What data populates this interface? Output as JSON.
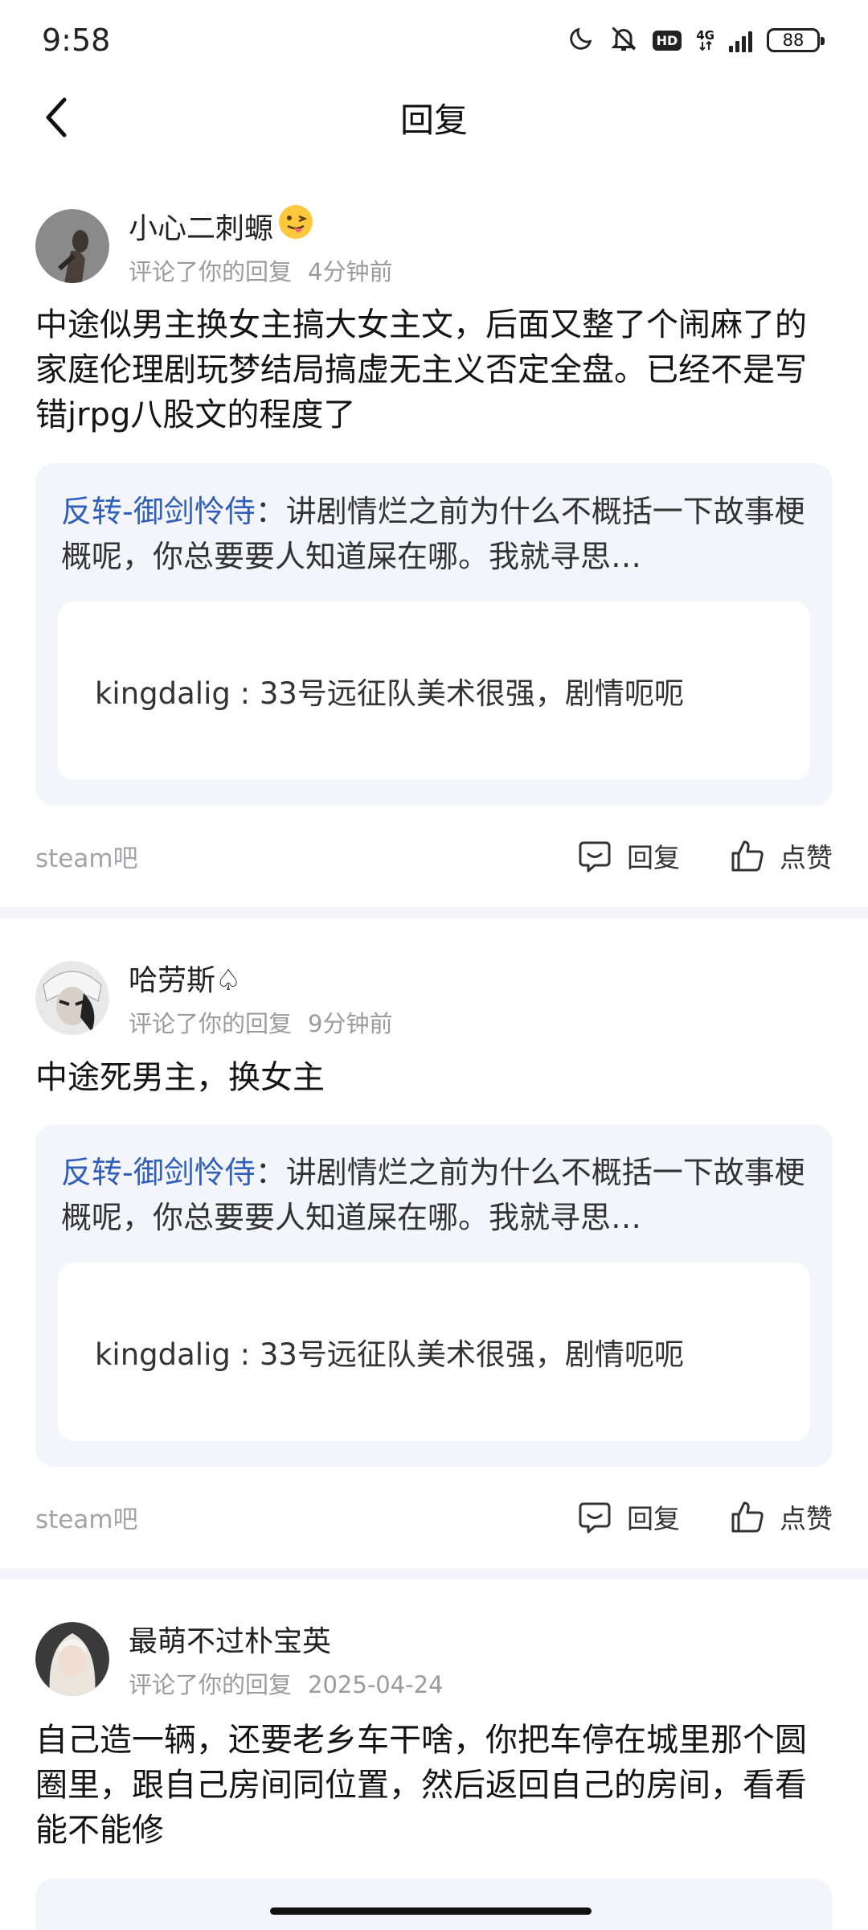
{
  "status_bar": {
    "time": "9:58",
    "network": "4G",
    "hd": "HD",
    "battery": "88"
  },
  "header": {
    "title": "回复"
  },
  "comments": [
    {
      "username": "小心二刺螈",
      "action_text": "评论了你的回复",
      "time": "4分钟前",
      "content": "中途似男主换女主搞大女主文，后面又整了个闹麻了的家庭伦理剧玩梦结局搞虚无主义否定全盘。已经不是写错jrpg八股文的程度了",
      "quote_author": "反转-御剑怜侍",
      "quote_sep": "：",
      "quote_text": "讲剧情烂之前为什么不概括一下故事梗概呢，你总要要人知道屎在哪。我就寻思…",
      "inner_text": "kingdalig : 33号远征队美术很强，剧情呃呃",
      "forum": "steam吧",
      "reply_label": "回复",
      "like_label": "点赞"
    },
    {
      "username": "哈劳斯♤",
      "action_text": "评论了你的回复",
      "time": "9分钟前",
      "content": "中途死男主，换女主",
      "quote_author": "反转-御剑怜侍",
      "quote_sep": "：",
      "quote_text": "讲剧情烂之前为什么不概括一下故事梗概呢，你总要要人知道屎在哪。我就寻思…",
      "inner_text": "kingdalig : 33号远征队美术很强，剧情呃呃",
      "forum": "steam吧",
      "reply_label": "回复",
      "like_label": "点赞"
    },
    {
      "username": "最萌不过朴宝英",
      "action_text": "评论了你的回复",
      "time": "2025-04-24",
      "content": "自己造一辆，还要老乡车干啥，你把车停在城里那个圆圈里，跟自己房间同位置，然后返回自己的房间，看看能不能修"
    }
  ]
}
